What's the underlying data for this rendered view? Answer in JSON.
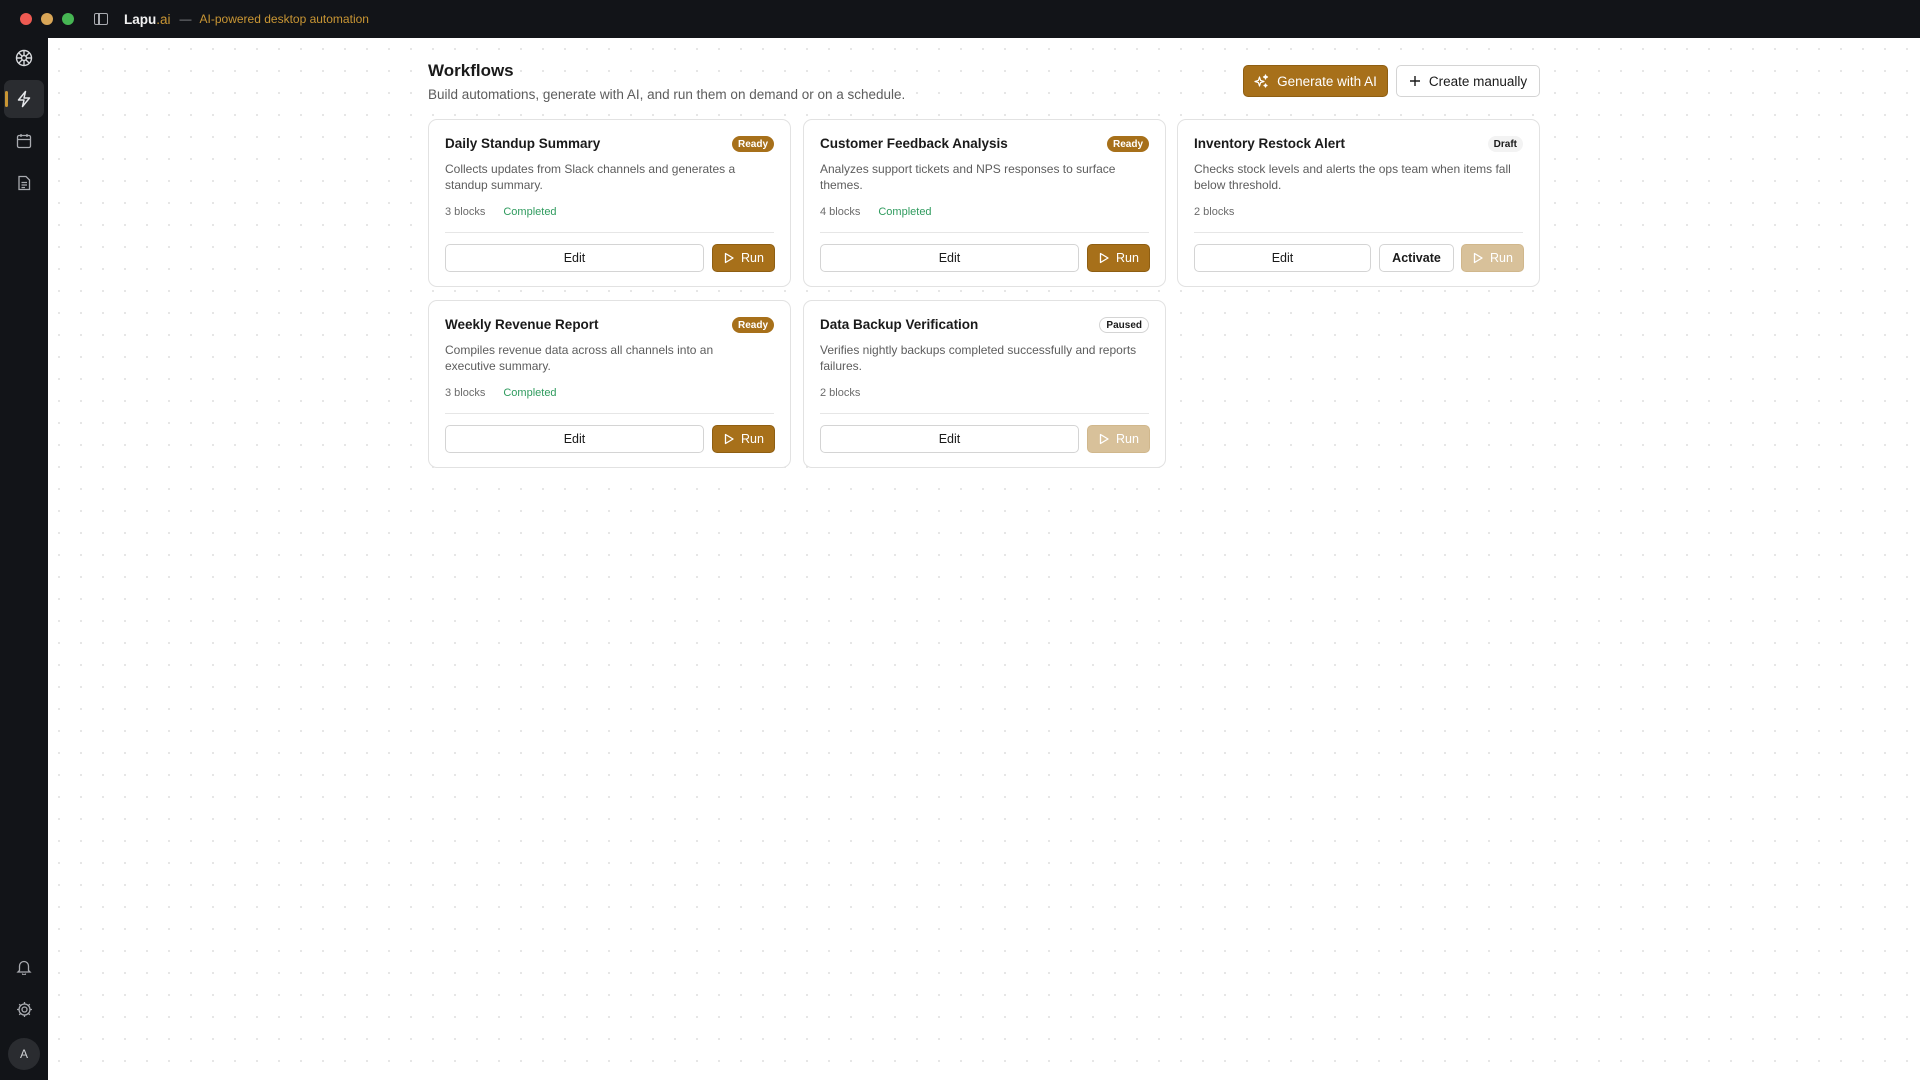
{
  "titlebar": {
    "brand_name": "Lapu",
    "brand_tld": ".ai",
    "separator": "—",
    "tagline": "AI-powered desktop automation"
  },
  "sidebar": {
    "items": [
      {
        "name": "logo",
        "icon": "logo-icon"
      },
      {
        "name": "workflows",
        "icon": "lightning-icon",
        "active": true
      },
      {
        "name": "schedule",
        "icon": "calendar-icon"
      },
      {
        "name": "documents",
        "icon": "document-icon"
      }
    ],
    "bottom": [
      {
        "name": "notifications",
        "icon": "bell-icon"
      },
      {
        "name": "settings",
        "icon": "gear-icon"
      }
    ],
    "avatar_initial": "A"
  },
  "header": {
    "title": "Workflows",
    "subtitle": "Build automations, generate with AI, and run them on demand or on a schedule.",
    "generate_label": "Generate with AI",
    "create_label": "Create manually"
  },
  "colors": {
    "accent": "#a7701a",
    "accent_disabled": "#d8c19a",
    "success": "#2f9b5e",
    "chrome": "#121418"
  },
  "workflows": [
    {
      "title": "Daily Standup Summary",
      "badge": "Ready",
      "description": "Collects updates from Slack channels and generates a standup summary.",
      "blocks": "3 blocks",
      "status": "Completed",
      "edit_label": "Edit",
      "run_label": "Run"
    },
    {
      "title": "Customer Feedback Analysis",
      "badge": "Ready",
      "description": "Analyzes support tickets and NPS responses to surface themes.",
      "blocks": "4 blocks",
      "status": "Completed",
      "edit_label": "Edit",
      "run_label": "Run"
    },
    {
      "title": "Inventory Restock Alert",
      "badge": "Draft",
      "description": "Checks stock levels and alerts the ops team when items fall below threshold.",
      "blocks": "2 blocks",
      "edit_label": "Edit",
      "activate_label": "Activate",
      "run_label": "Run"
    },
    {
      "title": "Weekly Revenue Report",
      "badge": "Ready",
      "description": "Compiles revenue data across all channels into an executive summary.",
      "blocks": "3 blocks",
      "status": "Completed",
      "edit_label": "Edit",
      "run_label": "Run"
    },
    {
      "title": "Data Backup Verification",
      "badge": "Paused",
      "description": "Verifies nightly backups completed successfully and reports failures.",
      "blocks": "2 blocks",
      "edit_label": "Edit",
      "run_label": "Run"
    }
  ]
}
